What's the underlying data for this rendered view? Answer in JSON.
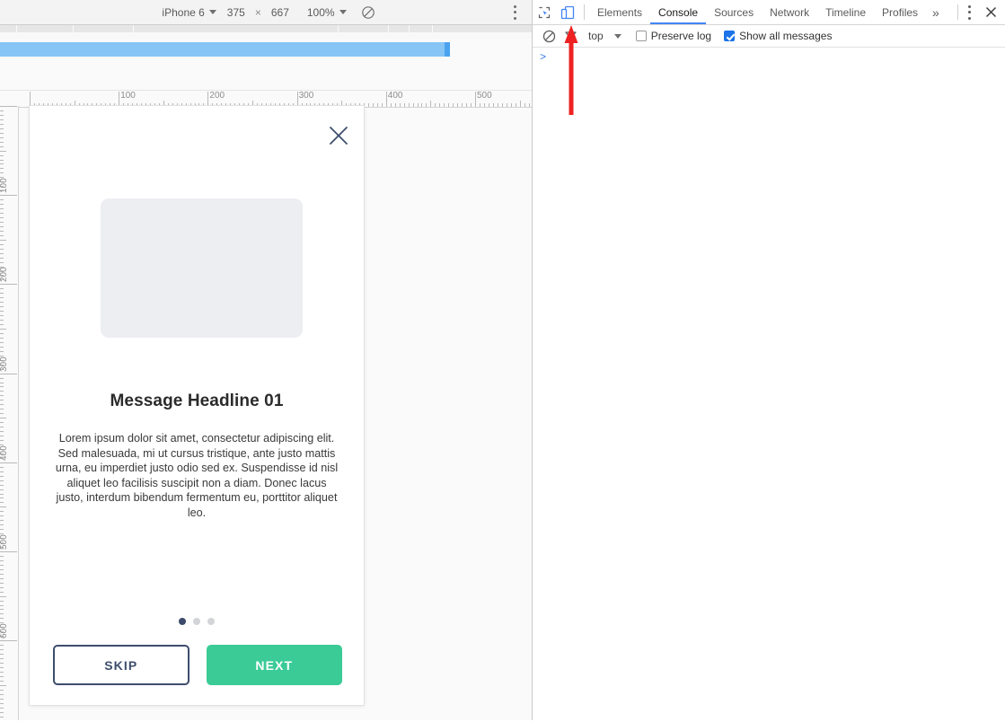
{
  "device_toolbar": {
    "device_name": "iPhone 6",
    "width": "375",
    "sep": "×",
    "height": "667",
    "zoom": "100%",
    "rotate_icon": "rotate-device-icon",
    "menu_icon": "more-options-icon"
  },
  "rulers": {
    "horizontal_labels": [
      "100",
      "200",
      "300",
      "400",
      "500"
    ],
    "vertical_labels": [
      "100",
      "200",
      "300",
      "400",
      "500",
      "600"
    ]
  },
  "phone": {
    "close_icon": "close-icon",
    "hero_placeholder": "image-placeholder",
    "headline": "Message Headline 01",
    "body": "Lorem ipsum dolor sit amet, consectetur adipiscing elit. Sed malesuada, mi ut cursus tristique, ante justo mattis urna, eu imperdiet justo odio sed ex. Suspendisse id nisl aliquet leo facilisis suscipit non a diam. Donec lacus justo, interdum bibendum fermentum eu, porttitor aliquet leo.",
    "dots_total": 3,
    "dots_active_index": 0,
    "skip_label": "SKIP",
    "next_label": "NEXT",
    "colors": {
      "next_bg": "#3bcb96",
      "skip_border": "#3d4e6c",
      "dot_active": "#3c4a6b",
      "placeholder": "#eceef1"
    }
  },
  "devtools": {
    "inspect_icon": "inspect-element-icon",
    "device_toggle_icon": "toggle-device-toolbar-icon",
    "tabs": [
      {
        "label": "Elements",
        "active": false
      },
      {
        "label": "Console",
        "active": true
      },
      {
        "label": "Sources",
        "active": false
      },
      {
        "label": "Network",
        "active": false
      },
      {
        "label": "Timeline",
        "active": false
      },
      {
        "label": "Profiles",
        "active": false
      }
    ],
    "more_tabs_label": "»",
    "menu_icon": "more-tools-icon",
    "close_icon": "close-devtools-icon",
    "console": {
      "clear_icon": "clear-console-icon",
      "filter_icon": "filter-icon",
      "context": "top",
      "context_caret_icon": "chevron-down-icon",
      "preserve_log_label": "Preserve log",
      "preserve_log_checked": false,
      "show_all_label": "Show all messages",
      "show_all_checked": true,
      "prompt": ">"
    }
  },
  "annotation": {
    "arrow": "red-arrow-up-icon",
    "color": "#ee2222"
  }
}
